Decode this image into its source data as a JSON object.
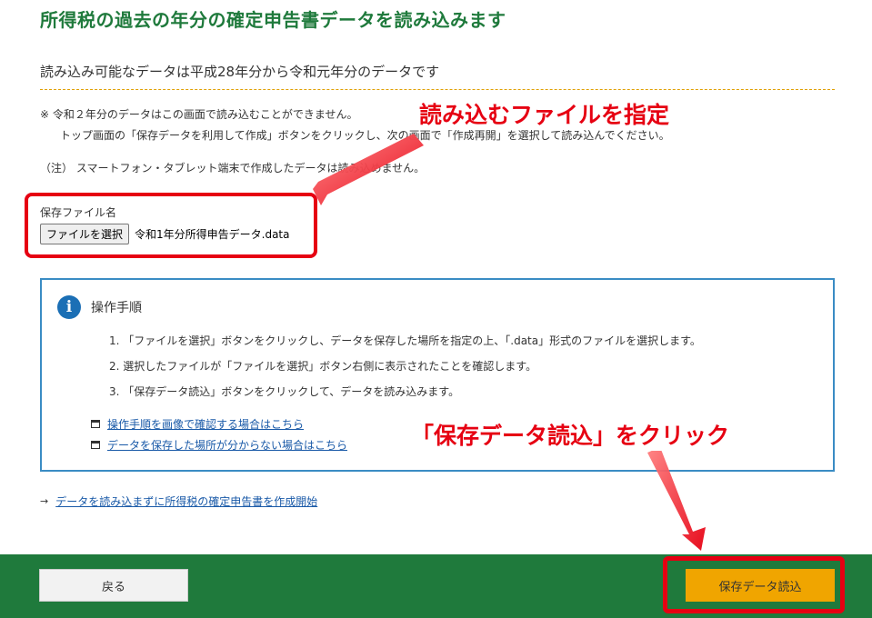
{
  "header": {
    "title": "所得税の過去の年分の確定申告書データを読み込みます",
    "subtitle": "読み込み可能なデータは平成28年分から令和元年分のデータです"
  },
  "notes": {
    "note1": "※ 令和２年分のデータはこの画面で読み込むことができません。",
    "note2": "トップ画面の「保存データを利用して作成」ボタンをクリックし、次の画面で「作成再開」を選択して読み込んでください。",
    "note3": "（注） スマートフォン・タブレット端末で作成したデータは読み込めません。"
  },
  "file_picker": {
    "label": "保存ファイル名",
    "button_label": "ファイルを選択",
    "file_name": "令和1年分所得申告データ.data"
  },
  "guide": {
    "title": "操作手順",
    "steps": [
      "1. 「ファイルを選択」ボタンをクリックし、データを保存した場所を指定の上、「.data」形式のファイルを選択します。",
      "2. 選択したファイルが「ファイルを選択」ボタン右側に表示されたことを確認します。",
      "3. 「保存データ読込」ボタンをクリックして、データを読み込みます。"
    ],
    "links": [
      "操作手順を画像で確認する場合はこちら",
      "データを保存した場所が分からない場合はこちら"
    ]
  },
  "bottom_link": {
    "arrow": "→",
    "text": "データを読み込まずに所得税の確定申告書を作成開始"
  },
  "footer": {
    "back_label": "戻る",
    "load_label": "保存データ読込"
  },
  "annotations": {
    "callout1": "読み込むファイルを指定",
    "callout2": "「保存データ読込」をクリック"
  },
  "colors": {
    "brand_green": "#1f7a3c",
    "load_button": "#f0a500",
    "highlight_red": "#e60012",
    "link_blue": "#1a5aa8",
    "info_blue": "#1b6fb5"
  },
  "icons": {
    "info": "info-icon",
    "window": "window-icon",
    "arrow": "arrow-right-icon"
  }
}
